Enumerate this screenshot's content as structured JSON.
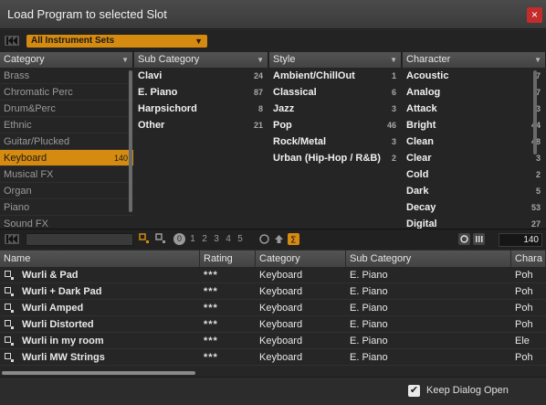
{
  "window": {
    "title": "Load Program to selected Slot",
    "close": "×"
  },
  "instrument_set": {
    "selected": "All Instrument Sets"
  },
  "columns": [
    {
      "header": "Category",
      "items": [
        {
          "label": "Brass",
          "count": ""
        },
        {
          "label": "Chromatic Perc",
          "count": ""
        },
        {
          "label": "Drum&Perc",
          "count": ""
        },
        {
          "label": "Ethnic",
          "count": ""
        },
        {
          "label": "Guitar/Plucked",
          "count": ""
        },
        {
          "label": "Keyboard",
          "count": "140",
          "selected": true
        },
        {
          "label": "Musical FX",
          "count": ""
        },
        {
          "label": "Organ",
          "count": ""
        },
        {
          "label": "Piano",
          "count": ""
        },
        {
          "label": "Sound FX",
          "count": ""
        }
      ]
    },
    {
      "header": "Sub Category",
      "items": [
        {
          "label": "Clavi",
          "count": "24"
        },
        {
          "label": "E. Piano",
          "count": "87"
        },
        {
          "label": "Harpsichord",
          "count": "8"
        },
        {
          "label": "Other",
          "count": "21"
        }
      ]
    },
    {
      "header": "Style",
      "items": [
        {
          "label": "Ambient/ChillOut",
          "count": "1"
        },
        {
          "label": "Classical",
          "count": "6"
        },
        {
          "label": "Jazz",
          "count": "3"
        },
        {
          "label": "Pop",
          "count": "46"
        },
        {
          "label": "Rock/Metal",
          "count": "3"
        },
        {
          "label": "Urban (Hip-Hop / R&B)",
          "count": "2"
        }
      ]
    },
    {
      "header": "Character",
      "items": [
        {
          "label": "Acoustic",
          "count": "7"
        },
        {
          "label": "Analog",
          "count": "7"
        },
        {
          "label": "Attack",
          "count": "3"
        },
        {
          "label": "Bright",
          "count": "44"
        },
        {
          "label": "Clean",
          "count": "48"
        },
        {
          "label": "Clear",
          "count": "3"
        },
        {
          "label": "Cold",
          "count": "2"
        },
        {
          "label": "Dark",
          "count": "5"
        },
        {
          "label": "Decay",
          "count": "53"
        },
        {
          "label": "Digital",
          "count": "27"
        }
      ]
    }
  ],
  "toolbar": {
    "rating_filter": [
      "0",
      "1",
      "2",
      "3",
      "4",
      "5"
    ],
    "result_count": "140"
  },
  "grid": {
    "headers": [
      "Name",
      "Rating",
      "Category",
      "Sub Category",
      "Chara"
    ],
    "rows": [
      [
        "Wurli & Pad",
        "***",
        "Keyboard",
        "E. Piano",
        "Poh"
      ],
      [
        "Wurli + Dark Pad",
        "***",
        "Keyboard",
        "E. Piano",
        "Poh"
      ],
      [
        "Wurli Amped",
        "***",
        "Keyboard",
        "E. Piano",
        "Poh"
      ],
      [
        "Wurli Distorted",
        "***",
        "Keyboard",
        "E. Piano",
        "Poh"
      ],
      [
        "Wurli in my room",
        "***",
        "Keyboard",
        "E. Piano",
        "Ele"
      ],
      [
        "Wurli MW Strings",
        "***",
        "Keyboard",
        "E. Piano",
        "Poh"
      ]
    ]
  },
  "footer": {
    "keep_open_label": "Keep Dialog Open",
    "keep_open_checked": true,
    "check_glyph": "✔"
  },
  "colors": {
    "accent": "#d58a10",
    "close": "#c42b2b"
  }
}
